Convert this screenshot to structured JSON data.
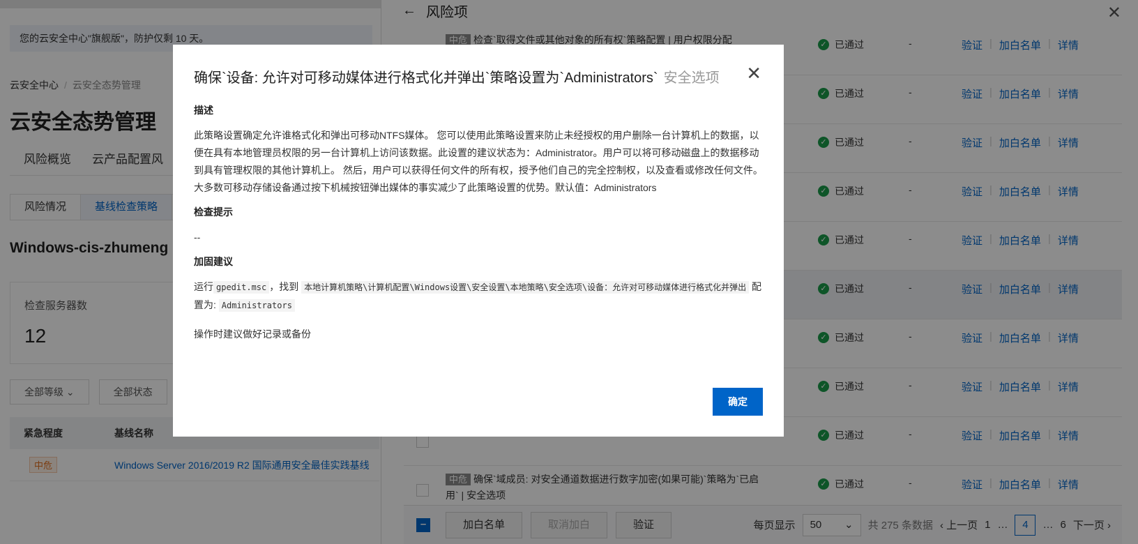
{
  "base": {
    "notice": "您的云安全中心\"旗舰版\"，防护仅剩 10 天。",
    "breadcrumb": [
      "云安全中心",
      "云安全态势管理"
    ],
    "title": "云安全态势管理",
    "main_tabs": [
      "风险概览",
      "云产品配置风"
    ],
    "sub_tabs": [
      "风险情况",
      "基线检查策略"
    ],
    "host": "Windows-cis-zhumeng",
    "stat_label": "检查服务器数",
    "stat_value": "12",
    "filters": [
      "全部等级",
      "全部状态"
    ],
    "table_headers": [
      "紧急程度",
      "基线名称"
    ],
    "row": {
      "level": "中危",
      "name": "Windows Server 2016/2019 R2 国际通用安全最佳实践基线"
    }
  },
  "drawer": {
    "title": "风险项",
    "rows": [
      {
        "tag": "中危",
        "text": "检查`取得文件或其他对象的所有权`策略配置 | 用户权限分配",
        "status": "已通过",
        "value": "-"
      },
      {
        "tag": "",
        "text": "",
        "status": "已通过",
        "value": "-"
      },
      {
        "tag": "",
        "text": "",
        "status": "已通过",
        "value": "-"
      },
      {
        "tag": "",
        "text": "",
        "status": "已通过",
        "value": "-"
      },
      {
        "tag": "",
        "text": "",
        "status": "已通过",
        "value": "-"
      },
      {
        "tag": "",
        "text": "",
        "status": "已通过",
        "value": "-"
      },
      {
        "tag": "",
        "text": "",
        "status": "已通过",
        "value": "-"
      },
      {
        "tag": "",
        "text": "制",
        "status": "已通过",
        "value": "-"
      },
      {
        "tag": "",
        "text": "可`",
        "status": "已通过",
        "value": "-"
      },
      {
        "tag": "中危",
        "text": "确保`域成员: 对安全通道数据进行数字加密(如果可能)`策略为`已启用` | 安全选项",
        "status": "已通过",
        "value": "-"
      }
    ],
    "actions": [
      "验证",
      "加白名单",
      "详情"
    ],
    "footer": {
      "buttons": [
        "加白名单",
        "取消加白",
        "验证"
      ],
      "per_page_label": "每页显示",
      "per_page": "50",
      "total": "共 275 条数据",
      "prev": "上一页",
      "pages": [
        "1",
        "…",
        "4",
        "…",
        "6"
      ],
      "next": "下一页"
    }
  },
  "modal": {
    "title": "确保`设备: 允许对可移动媒体进行格式化并弹出`策略设置为`Administrators`",
    "title_suffix": "安全选项",
    "sec_desc": "描述",
    "desc": "此策略设置确定允许谁格式化和弹出可移动NTFS媒体。 您可以使用此策略设置来防止未经授权的用户删除一台计算机上的数据，以便在具有本地管理员权限的另一台计算机上访问该数据。此设置的建议状态为：Administrator。用户可以将可移动磁盘上的数据移动到具有管理权限的其他计算机上。 然后，用户可以获得任何文件的所有权，授予他们自己的完全控制权，以及查看或修改任何文件。 大多数可移动存储设备通过按下机械按钮弹出媒体的事实减少了此策略设置的优势。默认值：Administrators",
    "sec_hint": "检查提示",
    "hint": "--",
    "sec_fix": "加固建议",
    "fix_run": "运行",
    "fix_cmd": "gpedit.msc",
    "fix_find": "，找到",
    "fix_path": "本地计算机策略\\计算机配置\\Windows设置\\安全设置\\本地策略\\安全选项\\设备：允许对可移动媒体进行格式化并弹出",
    "fix_config": "配置为:",
    "fix_value": "Administrators",
    "backup_note": "操作时建议做好记录或备份",
    "ok": "确定"
  }
}
